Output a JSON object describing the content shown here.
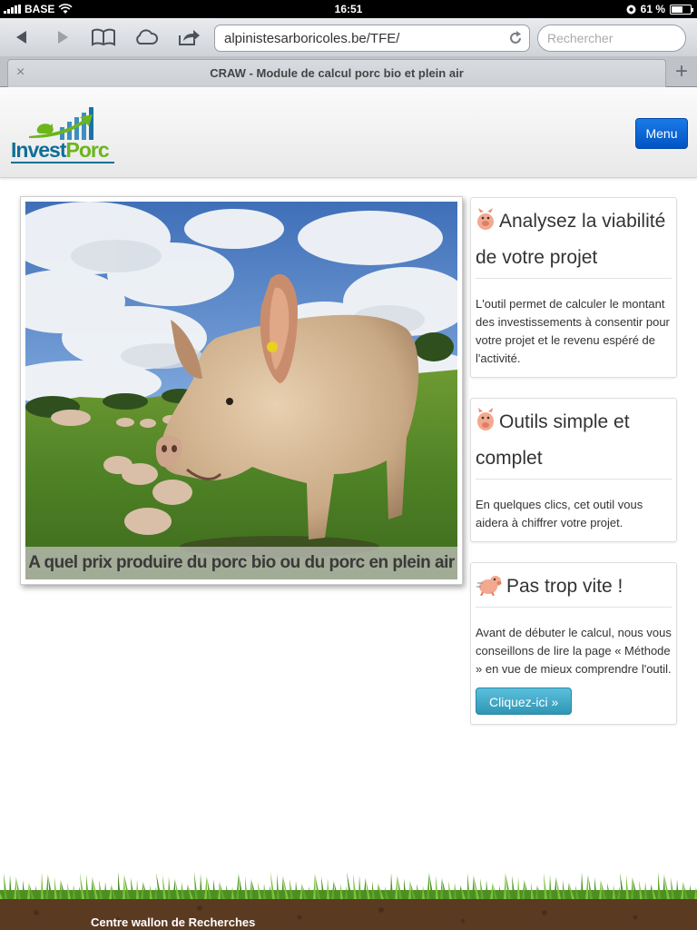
{
  "status_bar": {
    "carrier": "BASE",
    "time": "16:51",
    "battery": "61 %",
    "battery_level": 0.61
  },
  "browser": {
    "url": "alpinistesarboricoles.be/TFE/",
    "search_placeholder": "Rechercher",
    "tab_title": "CRAW - Module de calcul porc bio et plein air",
    "tab_close": "×",
    "new_tab": "+",
    "icons": [
      "back-icon",
      "forward-icon",
      "bookmarks-icon",
      "cloud-icon",
      "share-icon",
      "reload-icon"
    ]
  },
  "header": {
    "logo_part1": "Invest",
    "logo_part2": "Porc",
    "menu_label": "Menu",
    "colors": {
      "logo_blue": "#0f6f96",
      "logo_green": "#6cb51c",
      "menu_button": "#0a66d6"
    }
  },
  "hero": {
    "caption": "A quel prix produire du porc bio ou du porc en plein air ?"
  },
  "cards": [
    {
      "title": "Analysez la viabilité de votre projet",
      "text": "L'outil permet de calculer le montant des investissements à consentir pour votre projet et le revenu espéré de l'activité."
    },
    {
      "title": "Outils simple et complet",
      "text": "En quelques clics, cet outil vous aidera à chiffrer votre projet."
    },
    {
      "title": "Pas trop vite !",
      "text": "Avant de débuter le calcul, nous vous conseillons de lire la page « Méthode » en vue de mieux comprendre l'outil.",
      "button": "Cliquez-ici »"
    }
  ],
  "footer": {
    "text": "Centre wallon de Recherches"
  }
}
